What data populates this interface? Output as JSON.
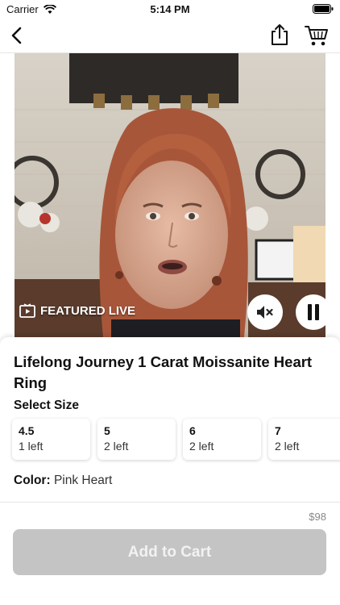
{
  "status_bar": {
    "carrier": "Carrier",
    "time": "5:14 PM"
  },
  "nav": {
    "back_icon": "chevron-left-icon",
    "share_icon": "share-icon",
    "cart_icon": "cart-icon"
  },
  "video": {
    "badge_label": "FEATURED LIVE",
    "badge_icon": "video-play-icon",
    "mute_icon": "speaker-muted-icon",
    "pause_icon": "pause-icon"
  },
  "product": {
    "title": "Lifelong Journey 1 Carat Moissanite Heart Ring",
    "size_heading": "Select Size",
    "sizes": [
      {
        "value": "4.5",
        "stock": "1 left"
      },
      {
        "value": "5",
        "stock": "2 left"
      },
      {
        "value": "6",
        "stock": "2 left"
      },
      {
        "value": "7",
        "stock": "2 left"
      }
    ],
    "color_label": "Color:",
    "color_value": "Pink Heart"
  },
  "footer": {
    "price": "$98",
    "add_to_cart_label": "Add to Cart"
  },
  "colors": {
    "button_disabled": "#c4c4c4",
    "accent_text": "#111111"
  }
}
